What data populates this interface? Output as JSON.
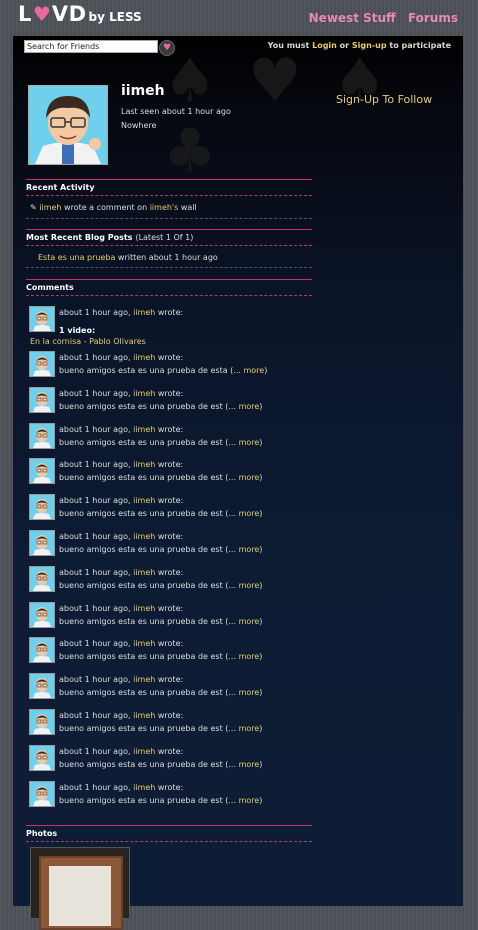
{
  "header": {
    "logo_big": "L",
    "logo_heart": "♥",
    "logo_rest": "VD",
    "logo_small": "by LESS",
    "nav": [
      {
        "label": "Newest Stuff"
      },
      {
        "label": "Forums"
      }
    ]
  },
  "search": {
    "value": "Search for Friends"
  },
  "login": {
    "prefix": "You must",
    "login_label": "Login",
    "or": "or",
    "signup_label": "Sign-up",
    "suffix": "to participate"
  },
  "profile": {
    "username": "iimeh",
    "last_seen": "Last seen about 1 hour ago",
    "location": "Nowhere"
  },
  "sidebar": {
    "follow_label": "Sign-Up To Follow"
  },
  "recent_activity": {
    "title": "Recent Activity",
    "actor": "iimeh",
    "action": "wrote a comment on",
    "target": "iimeh's",
    "object": "wall"
  },
  "blog_posts": {
    "title": "Most Recent Blog Posts",
    "count_label": "(Latest 1 Of 1)",
    "post_title": "Esta es una prueba",
    "post_meta": "written about 1 hour ago"
  },
  "comments": {
    "title": "Comments",
    "first": {
      "time": "about 1 hour ago,",
      "author": "iimeh",
      "verb": "wrote:",
      "video_label": "1 video:",
      "video_title": "En la cornisa - Pablo Olivares"
    },
    "items": [
      {
        "time": "about 1 hour ago,",
        "author": "iimeh",
        "verb": "wrote:",
        "text": "bueno amigos esta es una prueba de esta (...",
        "more": "more",
        "close": ")"
      },
      {
        "time": "about 1 hour ago,",
        "author": "iimeh",
        "verb": "wrote:",
        "text": "bueno amigos esta es una prueba de est (...",
        "more": "more",
        "close": ")"
      },
      {
        "time": "about 1 hour ago,",
        "author": "iimeh",
        "verb": "wrote:",
        "text": "bueno amigos esta es una prueba de est (...",
        "more": "more",
        "close": ")"
      },
      {
        "time": "about 1 hour ago,",
        "author": "iimeh",
        "verb": "wrote:",
        "text": "bueno amigos esta es una prueba de est (...",
        "more": "more",
        "close": ")"
      },
      {
        "time": "about 1 hour ago,",
        "author": "iimeh",
        "verb": "wrote:",
        "text": "bueno amigos esta es una prueba de est (...",
        "more": "more",
        "close": ")"
      },
      {
        "time": "about 1 hour ago,",
        "author": "iimeh",
        "verb": "wrote:",
        "text": "bueno amigos esta es una prueba de est (...",
        "more": "more",
        "close": ")"
      },
      {
        "time": "about 1 hour ago,",
        "author": "iimeh",
        "verb": "wrote:",
        "text": "bueno amigos esta es una prueba de est (...",
        "more": "more",
        "close": ")"
      },
      {
        "time": "about 1 hour ago,",
        "author": "iimeh",
        "verb": "wrote:",
        "text": "bueno amigos esta es una prueba de est (...",
        "more": "more",
        "close": ")"
      },
      {
        "time": "about 1 hour ago,",
        "author": "iimeh",
        "verb": "wrote:",
        "text": "bueno amigos esta es una prueba de est (...",
        "more": "more",
        "close": ")"
      },
      {
        "time": "about 1 hour ago,",
        "author": "iimeh",
        "verb": "wrote:",
        "text": "bueno amigos esta es una prueba de est (...",
        "more": "more",
        "close": ")"
      },
      {
        "time": "about 1 hour ago,",
        "author": "iimeh",
        "verb": "wrote:",
        "text": "bueno amigos esta es una prueba de est (...",
        "more": "more",
        "close": ")"
      },
      {
        "time": "about 1 hour ago,",
        "author": "iimeh",
        "verb": "wrote:",
        "text": "bueno amigos esta es una prueba de est (...",
        "more": "more",
        "close": ")"
      },
      {
        "time": "about 1 hour ago,",
        "author": "iimeh",
        "verb": "wrote:",
        "text": "bueno amigos esta es una prueba de est (...",
        "more": "more",
        "close": ")"
      }
    ]
  },
  "photos": {
    "title": "Photos"
  },
  "colors": {
    "accent_pink": "#e78bb0",
    "link_yellow": "#e6cc6a",
    "divider": "#c8306a"
  }
}
